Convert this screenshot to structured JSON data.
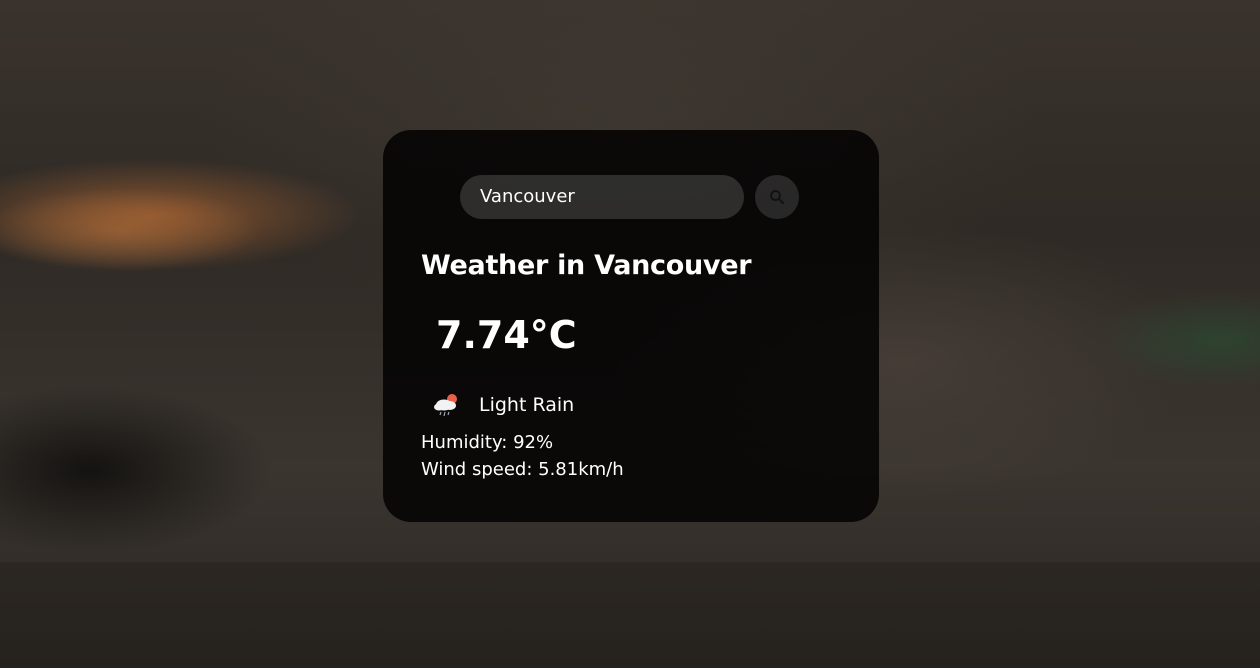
{
  "search": {
    "value": "Vancouver",
    "icon": "search-icon"
  },
  "weather": {
    "title": "Weather in Vancouver",
    "temperature": "7.74°C",
    "condition": "Light Rain",
    "condition_icon": "rain-cloud-icon",
    "humidity": "Humidity: 92%",
    "wind": "Wind speed: 5.81km/h"
  },
  "colors": {
    "card_background": "#000000",
    "text": "#ffffff",
    "sun_accent": "#e8604a"
  }
}
